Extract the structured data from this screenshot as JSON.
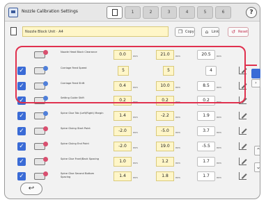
{
  "window": {
    "title": "Nozzle Calibration Settings"
  },
  "tabs": [
    {
      "label": ""
    },
    {
      "label": "1"
    },
    {
      "label": "2"
    },
    {
      "label": "3"
    },
    {
      "label": "4"
    },
    {
      "label": "5"
    },
    {
      "label": "6"
    }
  ],
  "help_label": "?",
  "document": {
    "name": "Nozzle Block Unit · A4",
    "copy_label": "Copy",
    "link_label": "Link",
    "reset_label": "Reset"
  },
  "rows": [
    {
      "checked": false,
      "label": "Nozzle Head Block Clearance",
      "v1": "0.0",
      "u1": "mm",
      "v2": "21.0",
      "u2": "mm",
      "v3": "20.5",
      "u3": "mm"
    },
    {
      "checked": true,
      "label": "Carriage Feed Speed",
      "v1": "5",
      "u1": "",
      "v2": "5",
      "u2": "",
      "v3": "4",
      "u3": ""
    },
    {
      "checked": true,
      "label": "Carriage Feed Shift",
      "v1": "0.4",
      "u1": "mm",
      "v2": "10.0",
      "u2": "mm",
      "v3": "8.5",
      "u3": "mm"
    },
    {
      "checked": true,
      "label": "Setting Guide Shift",
      "v1": "0.2",
      "u1": "mm",
      "v2": "0.2",
      "u2": "mm",
      "v3": "0.2",
      "u3": "mm"
    },
    {
      "checked": true,
      "label": "Spine Glue Tab (Left/Right) Margin",
      "v1": "1.4",
      "u1": "mm",
      "v2": "-2.2",
      "u2": "mm",
      "v3": "1.9",
      "u3": "mm"
    },
    {
      "checked": true,
      "label": "Spine Gluing Start Point",
      "v1": "-2.0",
      "u1": "mm",
      "v2": "-5.0",
      "u2": "mm",
      "v3": "3.7",
      "u3": "mm"
    },
    {
      "checked": true,
      "label": "Spine Gluing End Point",
      "v1": "-2.0",
      "u1": "mm",
      "v2": "19.0",
      "u2": "mm",
      "v3": "-5.5",
      "u3": "mm"
    },
    {
      "checked": true,
      "label": "Spine Glue Front/Back Spacing",
      "v1": "1.0",
      "u1": "mm",
      "v2": "1.2",
      "u2": "mm",
      "v3": "1.7",
      "u3": "mm"
    },
    {
      "checked": true,
      "label": "Spine Glue Second Bottom Spacing",
      "v1": "1.4",
      "u1": "mm",
      "v2": "1.8",
      "u2": "mm",
      "v3": "1.7",
      "u3": "mm"
    }
  ],
  "colors": {
    "accent": "#3a6bd6",
    "highlight": "#e0304e",
    "field": "#fff6c8"
  }
}
